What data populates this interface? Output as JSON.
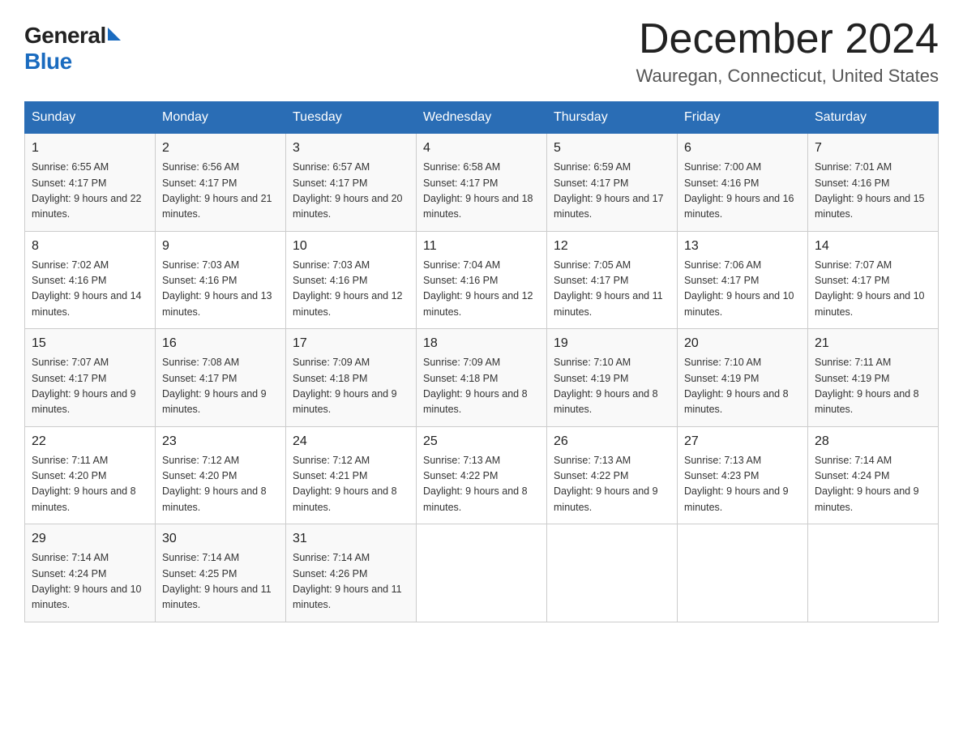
{
  "header": {
    "month_title": "December 2024",
    "location": "Wauregan, Connecticut, United States",
    "logo_general": "General",
    "logo_blue": "Blue"
  },
  "days_of_week": [
    "Sunday",
    "Monday",
    "Tuesday",
    "Wednesday",
    "Thursday",
    "Friday",
    "Saturday"
  ],
  "weeks": [
    [
      {
        "day": "1",
        "sunrise": "6:55 AM",
        "sunset": "4:17 PM",
        "daylight": "9 hours and 22 minutes."
      },
      {
        "day": "2",
        "sunrise": "6:56 AM",
        "sunset": "4:17 PM",
        "daylight": "9 hours and 21 minutes."
      },
      {
        "day": "3",
        "sunrise": "6:57 AM",
        "sunset": "4:17 PM",
        "daylight": "9 hours and 20 minutes."
      },
      {
        "day": "4",
        "sunrise": "6:58 AM",
        "sunset": "4:17 PM",
        "daylight": "9 hours and 18 minutes."
      },
      {
        "day": "5",
        "sunrise": "6:59 AM",
        "sunset": "4:17 PM",
        "daylight": "9 hours and 17 minutes."
      },
      {
        "day": "6",
        "sunrise": "7:00 AM",
        "sunset": "4:16 PM",
        "daylight": "9 hours and 16 minutes."
      },
      {
        "day": "7",
        "sunrise": "7:01 AM",
        "sunset": "4:16 PM",
        "daylight": "9 hours and 15 minutes."
      }
    ],
    [
      {
        "day": "8",
        "sunrise": "7:02 AM",
        "sunset": "4:16 PM",
        "daylight": "9 hours and 14 minutes."
      },
      {
        "day": "9",
        "sunrise": "7:03 AM",
        "sunset": "4:16 PM",
        "daylight": "9 hours and 13 minutes."
      },
      {
        "day": "10",
        "sunrise": "7:03 AM",
        "sunset": "4:16 PM",
        "daylight": "9 hours and 12 minutes."
      },
      {
        "day": "11",
        "sunrise": "7:04 AM",
        "sunset": "4:16 PM",
        "daylight": "9 hours and 12 minutes."
      },
      {
        "day": "12",
        "sunrise": "7:05 AM",
        "sunset": "4:17 PM",
        "daylight": "9 hours and 11 minutes."
      },
      {
        "day": "13",
        "sunrise": "7:06 AM",
        "sunset": "4:17 PM",
        "daylight": "9 hours and 10 minutes."
      },
      {
        "day": "14",
        "sunrise": "7:07 AM",
        "sunset": "4:17 PM",
        "daylight": "9 hours and 10 minutes."
      }
    ],
    [
      {
        "day": "15",
        "sunrise": "7:07 AM",
        "sunset": "4:17 PM",
        "daylight": "9 hours and 9 minutes."
      },
      {
        "day": "16",
        "sunrise": "7:08 AM",
        "sunset": "4:17 PM",
        "daylight": "9 hours and 9 minutes."
      },
      {
        "day": "17",
        "sunrise": "7:09 AM",
        "sunset": "4:18 PM",
        "daylight": "9 hours and 9 minutes."
      },
      {
        "day": "18",
        "sunrise": "7:09 AM",
        "sunset": "4:18 PM",
        "daylight": "9 hours and 8 minutes."
      },
      {
        "day": "19",
        "sunrise": "7:10 AM",
        "sunset": "4:19 PM",
        "daylight": "9 hours and 8 minutes."
      },
      {
        "day": "20",
        "sunrise": "7:10 AM",
        "sunset": "4:19 PM",
        "daylight": "9 hours and 8 minutes."
      },
      {
        "day": "21",
        "sunrise": "7:11 AM",
        "sunset": "4:19 PM",
        "daylight": "9 hours and 8 minutes."
      }
    ],
    [
      {
        "day": "22",
        "sunrise": "7:11 AM",
        "sunset": "4:20 PM",
        "daylight": "9 hours and 8 minutes."
      },
      {
        "day": "23",
        "sunrise": "7:12 AM",
        "sunset": "4:20 PM",
        "daylight": "9 hours and 8 minutes."
      },
      {
        "day": "24",
        "sunrise": "7:12 AM",
        "sunset": "4:21 PM",
        "daylight": "9 hours and 8 minutes."
      },
      {
        "day": "25",
        "sunrise": "7:13 AM",
        "sunset": "4:22 PM",
        "daylight": "9 hours and 8 minutes."
      },
      {
        "day": "26",
        "sunrise": "7:13 AM",
        "sunset": "4:22 PM",
        "daylight": "9 hours and 9 minutes."
      },
      {
        "day": "27",
        "sunrise": "7:13 AM",
        "sunset": "4:23 PM",
        "daylight": "9 hours and 9 minutes."
      },
      {
        "day": "28",
        "sunrise": "7:14 AM",
        "sunset": "4:24 PM",
        "daylight": "9 hours and 9 minutes."
      }
    ],
    [
      {
        "day": "29",
        "sunrise": "7:14 AM",
        "sunset": "4:24 PM",
        "daylight": "9 hours and 10 minutes."
      },
      {
        "day": "30",
        "sunrise": "7:14 AM",
        "sunset": "4:25 PM",
        "daylight": "9 hours and 11 minutes."
      },
      {
        "day": "31",
        "sunrise": "7:14 AM",
        "sunset": "4:26 PM",
        "daylight": "9 hours and 11 minutes."
      },
      null,
      null,
      null,
      null
    ]
  ]
}
